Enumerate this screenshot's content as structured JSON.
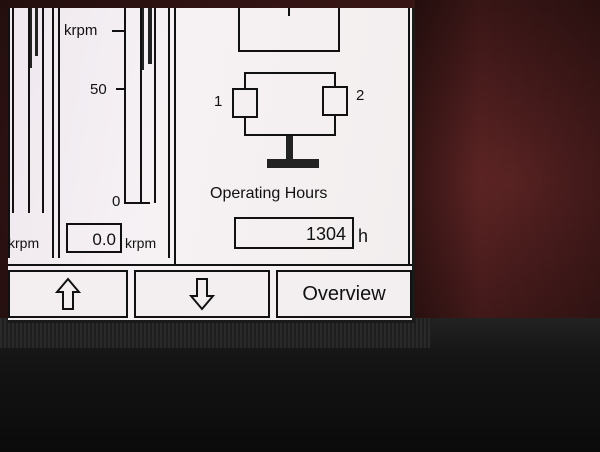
{
  "gauge_left": {
    "unit_bottom": "krpm"
  },
  "gauge_mid": {
    "unit_top": "krpm",
    "tick_50": "50",
    "tick_0": "0",
    "readout_value": "0.0",
    "readout_unit": "krpm"
  },
  "diagram": {
    "label_1": "1",
    "label_2": "2"
  },
  "operating_hours": {
    "label": "Operating Hours",
    "value": "1304",
    "unit": "h"
  },
  "nav": {
    "up_icon": "↑",
    "down_icon": "↓",
    "overview_label": "Overview"
  }
}
